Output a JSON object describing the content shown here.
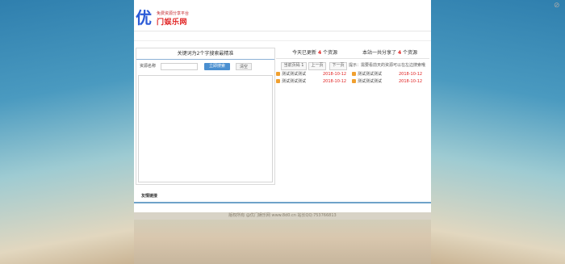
{
  "header": {
    "logo_mark": "优",
    "logo_tagline": "免费资源分享平台",
    "logo_name": "门娱乐网"
  },
  "left_panel": {
    "title": "关键词为2个字搜索最精准",
    "search_label": "资源名称",
    "search_placeholder": "",
    "search_button": "立即搜索",
    "clear_button": "清空"
  },
  "right_panel": {
    "today_prefix": "今天已更新",
    "today_count": "4",
    "today_suffix": "个资源",
    "total_prefix": "本站一共分享了",
    "total_count": "4",
    "total_suffix": "个资源",
    "pager": {
      "current": "当前页码 1",
      "prev": "上一页",
      "next": "下一页"
    },
    "hint": "提示：需要看前天的资源可以在左边搜索哦",
    "items": [
      {
        "name": "测试测试测试",
        "date": "2018-10-12"
      },
      {
        "name": "测试测试测试",
        "date": "2018-10-12"
      },
      {
        "name": "测试测试测试",
        "date": "2018-10-12"
      },
      {
        "name": "测试测试测试",
        "date": "2018-10-12"
      }
    ]
  },
  "links": {
    "title": "友情链接"
  },
  "footer": {
    "text": "版权所有 @优门娱乐网 www.8d0.cn 站长QQ:753766813"
  },
  "colors": {
    "accent": "#4a8fd0",
    "highlight": "#e02020"
  },
  "icons": {
    "top_right": "refresh-off-icon",
    "item": "file-icon"
  }
}
